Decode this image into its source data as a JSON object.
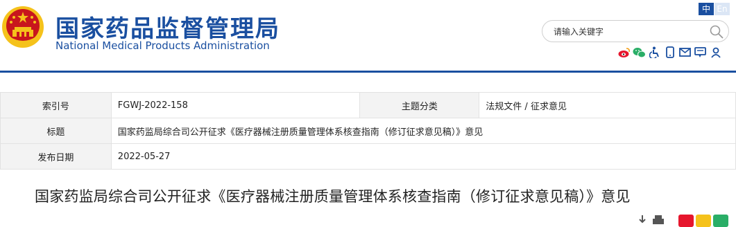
{
  "header": {
    "title_cn": "国家药品监督管理局",
    "title_en": "National Medical Products Administration",
    "lang_cn": "中",
    "lang_en": "En",
    "search_placeholder": "请输入关键字"
  },
  "social_icons": [
    "weibo-icon",
    "wechat-icon",
    "accessibility-icon",
    "mobile-icon",
    "mail-icon",
    "message-icon",
    "user-icon"
  ],
  "meta": {
    "index_label": "索引号",
    "index_value": "FGWJ-2022-158",
    "category_label": "主题分类",
    "category_value": "法规文件 / 征求意见",
    "title_label": "标题",
    "title_value": "国家药监局综合司公开征求《医疗器械注册质量管理体系核查指南（修订征求意见稿）》意见",
    "date_label": "发布日期",
    "date_value": "2022-05-27"
  },
  "article": {
    "title": "国家药监局综合司公开征求《医疗器械注册质量管理体系核查指南（修订征求意见稿）》意见"
  },
  "colors": {
    "brand": "#1a4fa0",
    "emblem_red": "#c8161d",
    "emblem_gold": "#f5c21b"
  }
}
